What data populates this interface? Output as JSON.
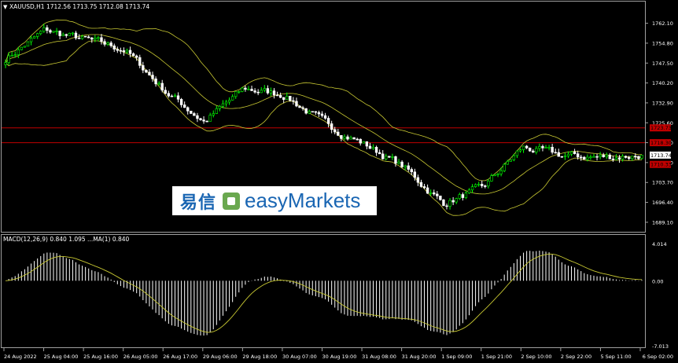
{
  "header": {
    "main_label": "XAUUSD,H1  1712.56 1713.75 1712.08 1713.74",
    "macd_label": "MACD(12,26,9) 0.840 1.095 ...MA(1) 0.840"
  },
  "watermark": {
    "cn": "易信",
    "en": "easyMarkets"
  },
  "price_ticks": [
    "1762.10",
    "1754.80",
    "1747.50",
    "1740.20",
    "1732.90",
    "1725.60",
    "1718.30",
    "1711.00",
    "1703.70",
    "1696.40",
    "1689.10"
  ],
  "price_tags": [
    {
      "label": "1723.73",
      "price": 1723.73,
      "bg": "#c00000",
      "color": "#ff0000"
    },
    {
      "label": "1718.30",
      "price": 1718.3,
      "bg": "#c00000",
      "color": "#ff0000"
    },
    {
      "label": "1713.74",
      "price": 1713.74,
      "bg": "#ffffff",
      "color": "#ffffff"
    },
    {
      "label": "1710.33",
      "price": 1710.33,
      "bg": "#c00000",
      "color": "#c00000"
    }
  ],
  "macd_ticks": [
    "4.014",
    "0.00",
    "-7.013"
  ],
  "time_labels": [
    "24 Aug 2022",
    "25 Aug 04:00",
    "25 Aug 16:00",
    "26 Aug 05:00",
    "26 Aug 17:00",
    "29 Aug 06:00",
    "29 Aug 18:00",
    "30 Aug 07:00",
    "30 Aug 19:00",
    "31 Aug 08:00",
    "31 Aug 20:00",
    "1 Sep 09:00",
    "1 Sep 21:00",
    "2 Sep 10:00",
    "2 Sep 22:00",
    "5 Sep 11:00",
    "6 Sep 02:00"
  ],
  "colors": {
    "bg": "#000000",
    "bull": "#00ff00",
    "bear": "#ffffff",
    "bands": "#c8c832",
    "grid": "#404040",
    "axis": "#a0a0a0",
    "macd_hist": "#ffffff",
    "macd_signal": "#c8c832",
    "hline": "#c00000"
  },
  "chart_data": {
    "type": "candlestick",
    "symbol": "XAUUSD",
    "timeframe": "H1",
    "last_ohlc": {
      "open": 1712.56,
      "high": 1713.75,
      "low": 1712.08,
      "close": 1713.74
    },
    "ylim": [
      1685.9,
      1766.6
    ],
    "horizontal_lines": [
      1723.73,
      1718.3
    ],
    "close_path": [
      {
        "t": "24 Aug 2022",
        "close": 1749.0
      },
      {
        "t": "25 Aug 04:00",
        "close": 1759.5
      },
      {
        "t": "25 Aug 16:00",
        "close": 1756.0
      },
      {
        "t": "26 Aug 05:00",
        "close": 1752.5
      },
      {
        "t": "26 Aug 17:00",
        "close": 1737.5
      },
      {
        "t": "29 Aug 06:00",
        "close": 1726.0
      },
      {
        "t": "29 Aug 18:00",
        "close": 1738.0
      },
      {
        "t": "30 Aug 07:00",
        "close": 1736.0
      },
      {
        "t": "30 Aug 19:00",
        "close": 1725.5
      },
      {
        "t": "31 Aug 08:00",
        "close": 1718.0
      },
      {
        "t": "31 Aug 20:00",
        "close": 1709.5
      },
      {
        "t": "1 Sep 09:00",
        "close": 1696.0
      },
      {
        "t": "1 Sep 21:00",
        "close": 1701.5
      },
      {
        "t": "2 Sep 10:00",
        "close": 1716.5
      },
      {
        "t": "2 Sep 22:00",
        "close": 1713.5
      },
      {
        "t": "5 Sep 11:00",
        "close": 1713.0
      },
      {
        "t": "6 Sep 02:00",
        "close": 1713.74
      }
    ],
    "macd": {
      "ylim": [
        -7.013,
        4.014
      ],
      "macd_value": 0.84,
      "signal_value": 1.095
    }
  }
}
